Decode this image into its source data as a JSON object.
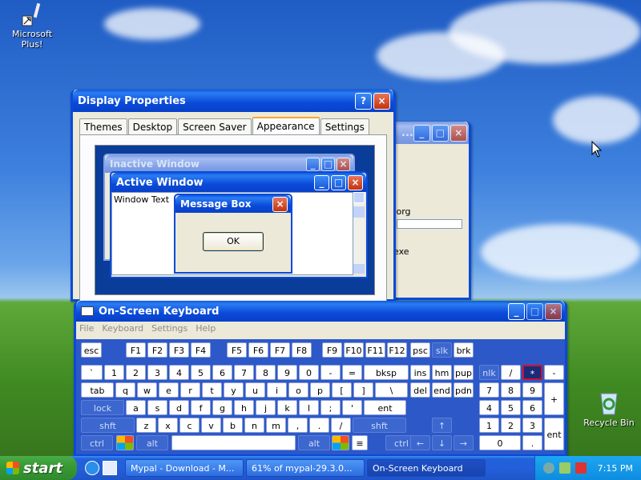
{
  "desktop": {
    "icons": [
      {
        "label": "Microsoft Plus!"
      },
      {
        "label": "Recycle Bin"
      }
    ]
  },
  "display_properties": {
    "title": "Display Properties",
    "tabs": [
      "Themes",
      "Desktop",
      "Screen Saver",
      "Appearance",
      "Settings"
    ],
    "active_tab": "Appearance",
    "preview": {
      "inactive_title": "Inactive Window",
      "active_title": "Active Window",
      "window_text": "Window Text",
      "message_title": "Message Box",
      "ok_label": "OK"
    }
  },
  "background_window": {
    "partial_text_1": ".org",
    "partial_text_2": "exe"
  },
  "osk": {
    "title": "On-Screen Keyboard",
    "menu": [
      "File",
      "Keyboard",
      "Settings",
      "Help"
    ],
    "keys": {
      "row0": [
        "esc",
        "F1",
        "F2",
        "F3",
        "F4",
        "F5",
        "F6",
        "F7",
        "F8",
        "F9",
        "F10",
        "F11",
        "F12",
        "psc",
        "slk",
        "brk"
      ],
      "row1": [
        "`",
        "1",
        "2",
        "3",
        "4",
        "5",
        "6",
        "7",
        "8",
        "9",
        "0",
        "-",
        "=",
        "bksp",
        "ins",
        "hm",
        "pup",
        "nlk",
        "/",
        "*",
        "-"
      ],
      "row2": [
        "tab",
        "q",
        "w",
        "e",
        "r",
        "t",
        "y",
        "u",
        "i",
        "o",
        "p",
        "[",
        "]",
        "\\",
        "del",
        "end",
        "pdn",
        "7",
        "8",
        "9",
        "+"
      ],
      "row3": [
        "lock",
        "a",
        "s",
        "d",
        "f",
        "g",
        "h",
        "j",
        "k",
        "l",
        ";",
        "'",
        "ent",
        "4",
        "5",
        "6"
      ],
      "row4": [
        "shft",
        "z",
        "x",
        "c",
        "v",
        "b",
        "n",
        "m",
        ",",
        ".",
        "/",
        "shft",
        "↑",
        "1",
        "2",
        "3",
        "ent"
      ],
      "row5": [
        "ctrl",
        "alt",
        "alt",
        "ctrl",
        "←",
        "↓",
        "→",
        "0",
        "."
      ]
    }
  },
  "taskbar": {
    "start_label": "start",
    "items": [
      "Mypal - Download - M...",
      "61% of mypal-29.3.0...",
      "On-Screen Keyboard"
    ],
    "clock": "7:15 PM"
  }
}
